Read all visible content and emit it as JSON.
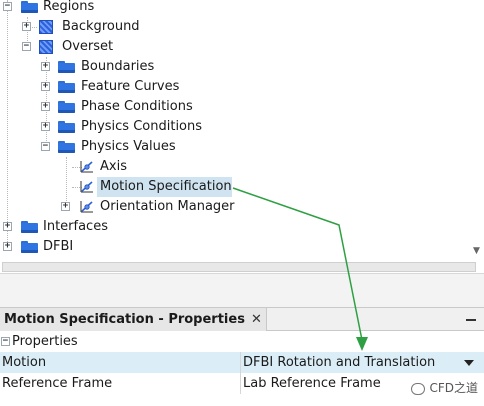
{
  "tree": {
    "regions": "Regions",
    "background": "Background",
    "overset": "Overset",
    "boundaries": "Boundaries",
    "feature_curves": "Feature Curves",
    "phase_conditions": "Phase Conditions",
    "physics_conditions": "Physics Conditions",
    "physics_values": "Physics Values",
    "axis": "Axis",
    "motion_specification": "Motion Specification",
    "orientation_manager": "Orientation Manager",
    "interfaces": "Interfaces",
    "dfbi": "DFBI"
  },
  "properties": {
    "tab_title": "Motion Specification - Properties",
    "close_glyph": "✕",
    "section": "Properties",
    "rows": [
      {
        "name": "Motion",
        "value": "DFBI Rotation and Translation"
      },
      {
        "name": "Reference Frame",
        "value": "Lab Reference Frame"
      }
    ]
  },
  "watermark": "CFD之道",
  "colors": {
    "selection": "#cfe3f1",
    "folder": "#2f74e0",
    "arrow": "#2ea043",
    "row_highlight": "#dbeef7"
  },
  "icons": {
    "expanded": "minus-box",
    "collapsed": "plus-box"
  }
}
